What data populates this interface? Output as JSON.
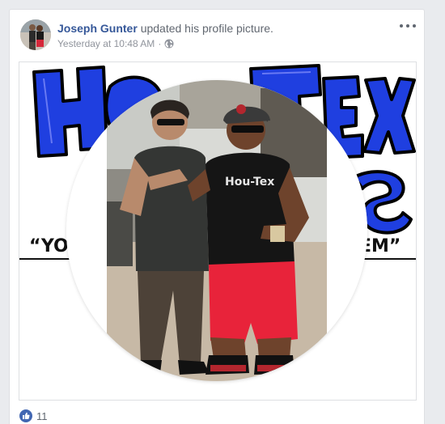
{
  "post": {
    "author_name": "Joseph Gunter",
    "action_text": "updated his profile picture.",
    "timestamp": "Yesterday at 10:48 AM",
    "separator": "·",
    "privacy_icon": "globe-icon",
    "more_icon": "more-options-icon"
  },
  "media": {
    "logo_lettering": "HOU-TEX ... \"YO ... EM\"",
    "shirt_lettering": "HOU-TEX"
  },
  "reactions": {
    "icon": "like-icon",
    "count": "11"
  },
  "colors": {
    "link": "#365899",
    "like_blue": "#4267b2",
    "logo_blue": "#1f3fe0",
    "shorts_red": "#e8233a"
  }
}
